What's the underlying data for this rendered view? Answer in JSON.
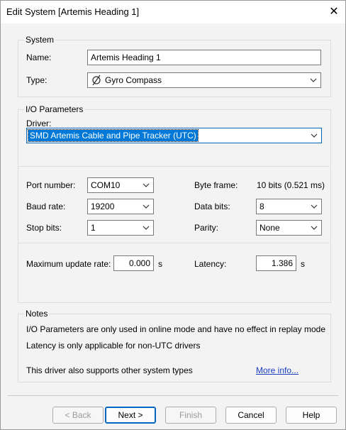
{
  "window": {
    "title": "Edit System [Artemis Heading 1]"
  },
  "system": {
    "legend": "System",
    "name_label": "Name:",
    "name_value": "Artemis Heading 1",
    "type_label": "Type:",
    "type_value": "Gyro Compass"
  },
  "io": {
    "legend": "I/O Parameters",
    "driver_label": "Driver:",
    "driver_value": "SMD Artemis Cable and Pipe Tracker (UTC)",
    "port_label": "Port number:",
    "port_value": "COM10",
    "baud_label": "Baud rate:",
    "baud_value": "19200",
    "stop_label": "Stop bits:",
    "stop_value": "1",
    "byteframe_label": "Byte frame:",
    "byteframe_value": "10 bits (0.521 ms)",
    "databits_label": "Data bits:",
    "databits_value": "8",
    "parity_label": "Parity:",
    "parity_value": "None",
    "max_update_label": "Maximum update rate:",
    "max_update_value": "0.000",
    "max_update_unit": "s",
    "latency_label": "Latency:",
    "latency_value": "1.386",
    "latency_unit": "s"
  },
  "notes": {
    "legend": "Notes",
    "line1": "I/O Parameters are only used in online mode and have no effect in replay mode",
    "line2": "Latency is only applicable for non-UTC drivers",
    "line3": "This driver also supports other system types",
    "more_info": "More info..."
  },
  "buttons": {
    "back": "< Back",
    "next": "Next >",
    "finish": "Finish",
    "cancel": "Cancel",
    "help": "Help"
  },
  "colors": {
    "selection": "#0078d7",
    "link": "#1a3fbf",
    "accent_border": "#0067c0"
  },
  "icons": {
    "close": "close-icon",
    "type": "gyro-compass-icon",
    "dropdown": "chevron-down-icon"
  }
}
